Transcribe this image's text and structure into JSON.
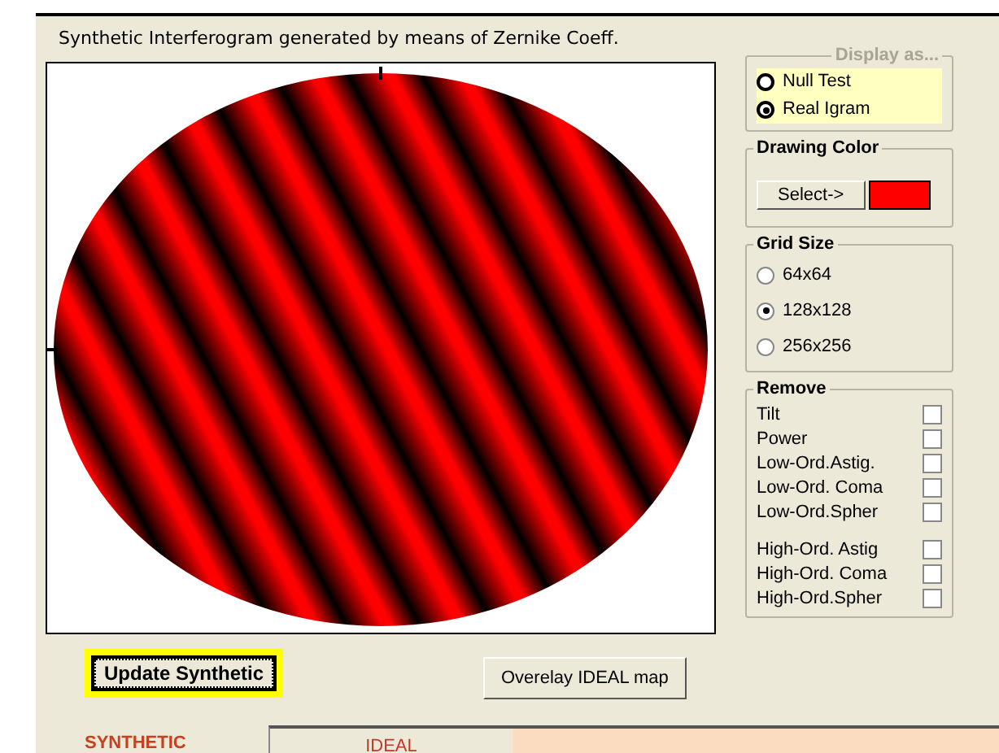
{
  "title": "Synthetic Interferogram generated by means of Zernike Coeff.",
  "display_as": {
    "legend": "Display as...",
    "options": [
      {
        "label": "Null Test",
        "selected": false
      },
      {
        "label": "Real Igram",
        "selected": true
      }
    ]
  },
  "drawing_color": {
    "legend": "Drawing Color",
    "button": "Select->",
    "color": "#ff0000"
  },
  "grid_size": {
    "legend": "Grid Size",
    "options": [
      {
        "label": "64x64",
        "selected": false
      },
      {
        "label": "128x128",
        "selected": true
      },
      {
        "label": "256x256",
        "selected": false
      }
    ]
  },
  "remove": {
    "legend": "Remove",
    "groups": [
      [
        {
          "label": "Tilt",
          "checked": false
        },
        {
          "label": "Power",
          "checked": false
        },
        {
          "label": "Low-Ord.Astig.",
          "checked": false
        },
        {
          "label": "Low-Ord. Coma",
          "checked": false
        },
        {
          "label": "Low-Ord.Spher",
          "checked": false
        }
      ],
      [
        {
          "label": "High-Ord. Astig",
          "checked": false
        },
        {
          "label": "High-Ord. Coma",
          "checked": false
        },
        {
          "label": "High-Ord.Spher",
          "checked": false
        }
      ]
    ]
  },
  "buttons": [
    {
      "label": "Update Synthetic",
      "focused": true
    },
    {
      "label": "Overelay IDEAL map",
      "focused": false
    }
  ],
  "tabs": [
    {
      "label": "SYNTHETIC",
      "selected": true
    },
    {
      "label": "IDEAL",
      "selected": false
    }
  ]
}
